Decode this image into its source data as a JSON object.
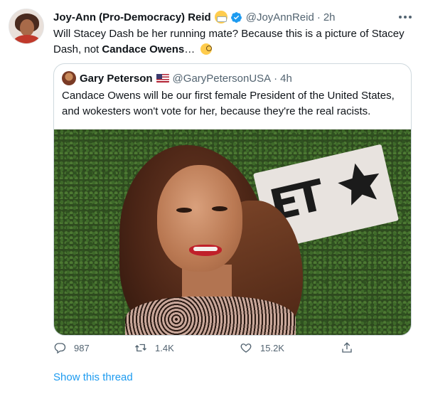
{
  "tweet": {
    "author": {
      "display_name": "Joy-Ann (Pro-Democracy) Reid",
      "handle": "@JoyAnnReid",
      "time": "2h",
      "avatar_icon": "profile-photo",
      "badge_icons": [
        "face-with-medical-mask-icon",
        "verified-badge-icon"
      ]
    },
    "text_part1": "Will Stacey Dash be her running mate? Because this is a picture of Stacey Dash, not ",
    "text_bold": "Candace Owens",
    "text_part2": "… ",
    "text_emoji_icon": "face-with-monocle-icon",
    "quoted": {
      "display_name": "Gary Peterson",
      "handle": "@GaryPetersonUSA",
      "time": "4h",
      "flag_icon": "us-flag-icon",
      "text": "Candace Owens will be our first female President of the United States, and wokesters won't vote for her, because they're the real racists.",
      "image_sign_text": "ET"
    },
    "actions": {
      "reply_count": "987",
      "retweet_count": "1.4K",
      "like_count": "15.2K"
    },
    "show_thread_label": "Show this thread"
  },
  "colors": {
    "link_blue": "#1d9bf0",
    "verified_blue": "#1d9bf0",
    "secondary_text": "#536471",
    "border": "#cfd9de"
  }
}
